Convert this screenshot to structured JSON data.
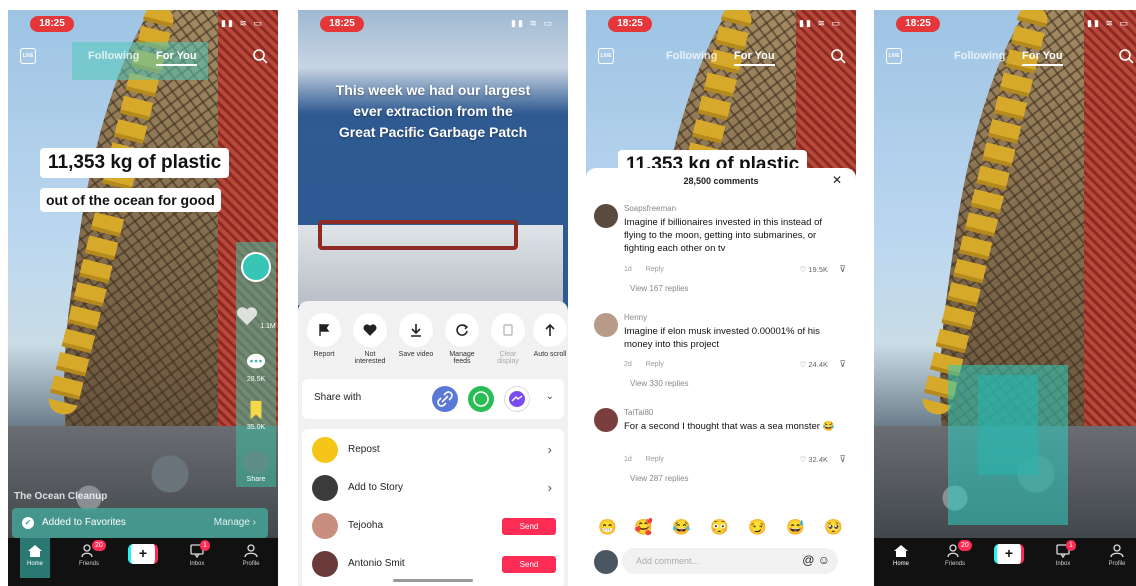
{
  "status": {
    "time": "18:25",
    "icons": "▮▮ ≋ ▭"
  },
  "nav": {
    "following": "Following",
    "for_you": "For You",
    "live": "LIVE"
  },
  "panel1": {
    "caption_big": "11,353 kg of plastic",
    "caption_small": "out of the ocean for good",
    "likes": "1.1M",
    "comments": "28.5K",
    "favorites": "35.0K",
    "share": "Share",
    "channel": "The Ocean Cleanup",
    "toast": "Added to Favorites",
    "toast_action": "Manage"
  },
  "bottom_nav": {
    "home": "Home",
    "friends": "Friends",
    "friends_badge": "20",
    "inbox": "Inbox",
    "inbox_badge": "1",
    "profile": "Profile",
    "plus": "+"
  },
  "panel2": {
    "headline": [
      "This week we had our largest",
      "ever extraction from the",
      "Great Pacific Garbage Patch"
    ],
    "actions": [
      {
        "label": "Report",
        "icon": "flag-icon"
      },
      {
        "label": "Not interested",
        "icon": "broken-heart-icon"
      },
      {
        "label": "Save video",
        "icon": "download-icon"
      },
      {
        "label": "Manage feeds",
        "icon": "refresh-icon"
      },
      {
        "label": "Clear display",
        "icon": "clear-icon"
      },
      {
        "label": "Auto scroll",
        "icon": "arrow-up-icon"
      }
    ],
    "share_with": "Share with",
    "rows": [
      {
        "label": "Repost",
        "icon": "repost-icon",
        "color": "#f5c518"
      },
      {
        "label": "Add to Story",
        "icon": "story-avatar",
        "color": "#3b3b3b"
      },
      {
        "label": "Tejooha",
        "icon": "friend-avatar",
        "color": "#c98f7e"
      },
      {
        "label": "Antonio Smit",
        "icon": "friend-avatar",
        "color": "#6a3a3a"
      }
    ],
    "send": "Send"
  },
  "panel3": {
    "caption_big": "11,353 kg of plastic",
    "title": "28,500 comments",
    "reply": "Reply",
    "comments": [
      {
        "user": "Soapsfreeman",
        "text": "Imagine if billionaires invested in this instead of flying to the moon, getting into submarines, or fighting each other on tv",
        "age": "1d",
        "likes": "19.5K",
        "view": "View 167 replies"
      },
      {
        "user": "Henny",
        "text": "Imagine if elon musk invested 0.00001% of his money into this project",
        "age": "2d",
        "likes": "24.4K",
        "view": "View 330 replies"
      },
      {
        "user": "TaiTai80",
        "text": "For a second I thought that was a sea monster 😂",
        "age": "1d",
        "likes": "32.4K",
        "view": "View 287 replies"
      }
    ],
    "emojis": [
      "😁",
      "🥰",
      "😂",
      "😳",
      "😏",
      "😅",
      "🥺"
    ],
    "add_comment": "Add comment...",
    "at": "@",
    "smile": "☺"
  },
  "colors": {
    "accent": "#fe2c55",
    "teal": "#25f4ee",
    "toast": "#46a096"
  }
}
